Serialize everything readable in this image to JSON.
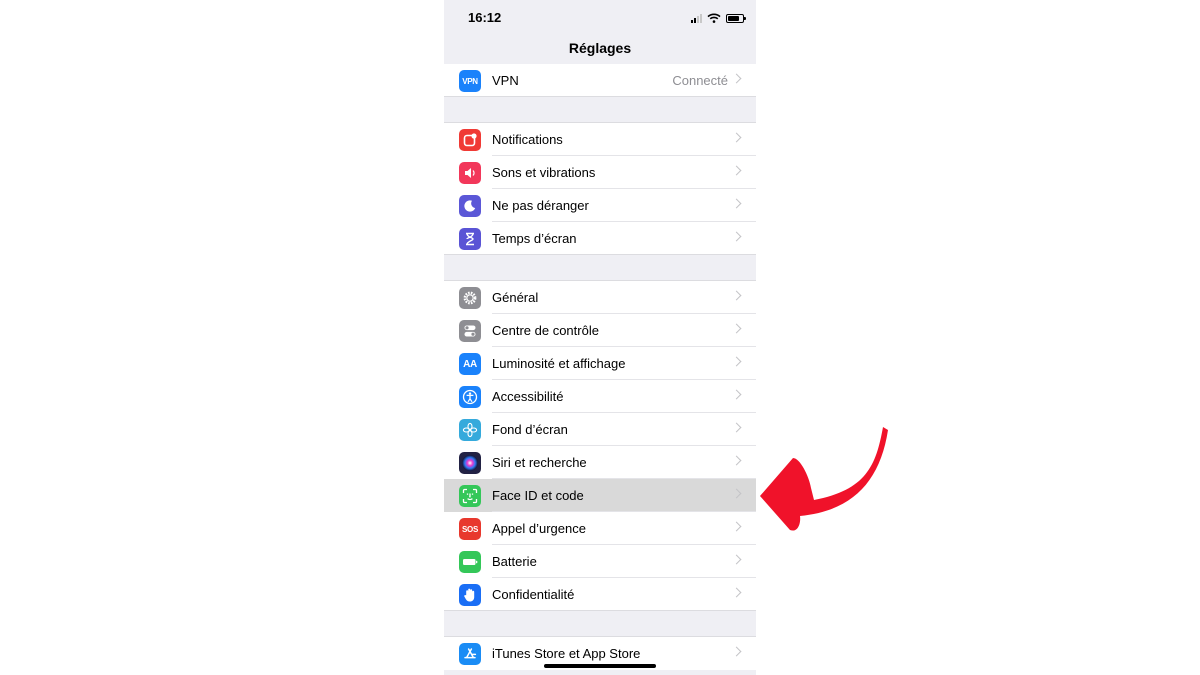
{
  "status": {
    "time": "16:12"
  },
  "nav": {
    "title": "Réglages"
  },
  "groups": [
    [
      {
        "label": "VPN",
        "value": "Connecté",
        "icon": "vpn-icon",
        "icon_text": "VPN",
        "color": "#1a82fb"
      }
    ],
    [
      {
        "label": "Notifications",
        "icon": "notifications-icon",
        "color": "#f03a35"
      },
      {
        "label": "Sons et vibrations",
        "icon": "speaker-icon",
        "color": "#f2375a"
      },
      {
        "label": "Ne pas déranger",
        "icon": "moon-icon",
        "color": "#5b57d7"
      },
      {
        "label": "Temps d’écran",
        "icon": "hourglass-icon",
        "color": "#5a54d5"
      }
    ],
    [
      {
        "label": "Général",
        "icon": "gear-icon",
        "color": "#8e8e93"
      },
      {
        "label": "Centre de contrôle",
        "icon": "toggles-icon",
        "color": "#8e8e93"
      },
      {
        "label": "Luminosité et affichage",
        "icon": "text-size-icon",
        "icon_text": "AA",
        "color": "#1a82fb"
      },
      {
        "label": "Accessibilité",
        "icon": "accessibility-icon",
        "color": "#1a82fb"
      },
      {
        "label": "Fond d’écran",
        "icon": "flower-icon",
        "color": "#35aadc"
      },
      {
        "label": "Siri et recherche",
        "icon": "siri-icon",
        "color": "#222244"
      },
      {
        "label": "Face ID et code",
        "icon": "face-id-icon",
        "color": "#34c759",
        "highlighted": true
      },
      {
        "label": "Appel d’urgence",
        "icon": "sos-icon",
        "icon_text": "SOS",
        "color": "#e8382d"
      },
      {
        "label": "Batterie",
        "icon": "battery-icon",
        "color": "#34c759"
      },
      {
        "label": "Confidentialité",
        "icon": "hand-icon",
        "color": "#1a6ef5"
      }
    ],
    [
      {
        "label": "iTunes Store et App Store",
        "icon": "app-store-icon",
        "color": "#1a8cf5"
      }
    ]
  ],
  "annotation": {
    "arrow_color": "#f0122a"
  }
}
